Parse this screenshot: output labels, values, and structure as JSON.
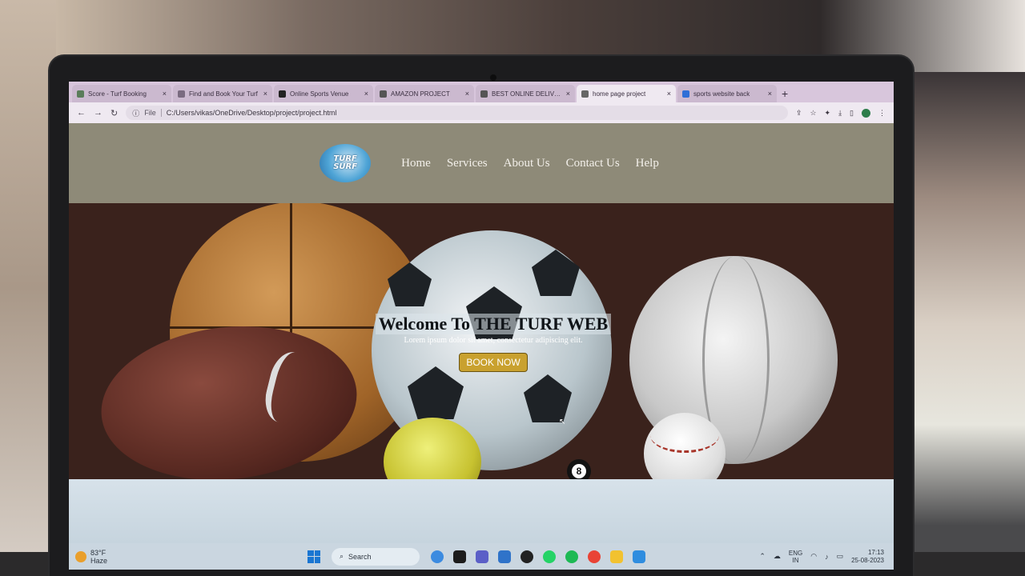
{
  "browser": {
    "tabs": [
      {
        "title": "Score - Turf Booking",
        "active": false,
        "fav_color": "#5a7d5a"
      },
      {
        "title": "Find and Book Your Turf",
        "active": false,
        "fav_color": "#7a6b80"
      },
      {
        "title": "Online Sports Venue",
        "active": false,
        "fav_color": "#222222"
      },
      {
        "title": "AMAZON PROJECT",
        "active": false,
        "fav_color": "#555555"
      },
      {
        "title": "BEST ONLINE DELIVERY",
        "active": false,
        "fav_color": "#555555"
      },
      {
        "title": "home page project",
        "active": true,
        "fav_color": "#666666"
      },
      {
        "title": "sports website back",
        "active": false,
        "fav_color": "#2f6fd6"
      }
    ],
    "tab_close": "×",
    "new_tab": "+",
    "url_scheme": "File",
    "url": "C:/Users/vikas/OneDrive/Desktop/project/project.html"
  },
  "site": {
    "logo_text": "TURF\nSURF",
    "nav": [
      "Home",
      "Services",
      "About Us",
      "Contact Us",
      "Help"
    ],
    "hero_title": "Welcome To THE TURF WEB",
    "hero_subtitle": "Lorem ipsum dolor sit amet, consectetur adipiscing elit.",
    "cta_label": "BOOK NOW",
    "ball_number": "8"
  },
  "taskbar": {
    "weather_temp": "83°F",
    "weather_desc": "Haze",
    "search_label": "Search",
    "lang_top": "ENG",
    "lang_bottom": "IN",
    "time": "17:13",
    "date": "25-08-2023"
  }
}
